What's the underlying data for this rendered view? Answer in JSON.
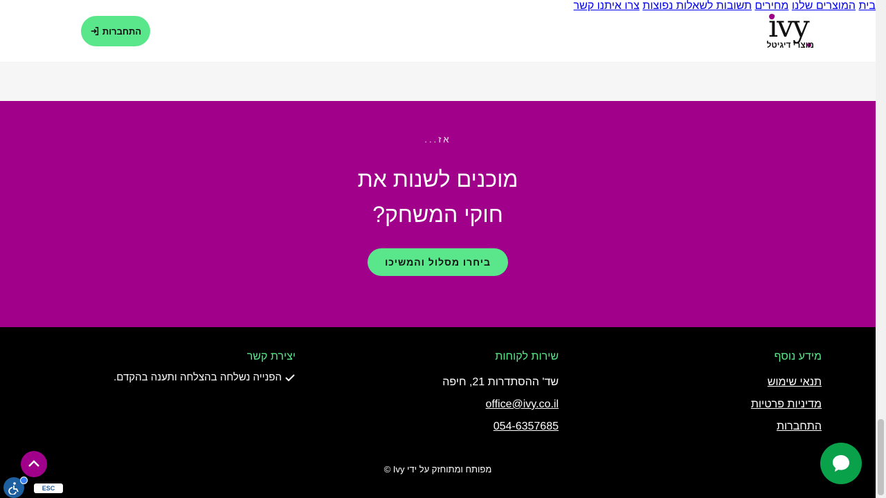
{
  "header": {
    "logo_text": "ivy",
    "logo_subtitle": "מוצרי דיגיטל",
    "nav": [
      {
        "label": "בית"
      },
      {
        "label": "המוצרים שלנו"
      },
      {
        "label": "מחירים"
      },
      {
        "label": "תשובות לשאלות נפוצות"
      },
      {
        "label": "צרו איתנו קשר"
      }
    ],
    "login_label": "התחברות",
    "login_icon": "login-icon"
  },
  "cta": {
    "eyebrow": "אז...",
    "title_line1": "מוכנים לשנות את",
    "title_line2": "חוקי המשחק?",
    "button_label": "ביחרו מסלול והמשיכו"
  },
  "footer": {
    "info": {
      "heading": "מידע נוסף",
      "links": [
        "תנאי שימוש",
        "מדיניות פרטיות",
        "התחברות"
      ]
    },
    "service": {
      "heading": "שירות לקוחות",
      "address": "שד' ההסתדרות 21, חיפה",
      "email": "office@ivy.co.il",
      "phone": "054-6357685"
    },
    "contact": {
      "heading": "יצירת קשר",
      "success_message": "הפנייה נשלחה בהצלחה ותענה בהקדם."
    },
    "copyright": "מפותח ומתוחזק על ידי Ivy ©"
  },
  "widgets": {
    "esc_label": "ESC",
    "chat_icon": "chat-bubble-icon",
    "scroll_top_icon": "chevron-up-icon",
    "accessibility_icon": "accessibility-icon"
  },
  "colors": {
    "brand_purple": "#a0008a",
    "accent_green": "#5ae68a",
    "chat_green": "#0aa14b",
    "footer_bg": "#000000"
  }
}
